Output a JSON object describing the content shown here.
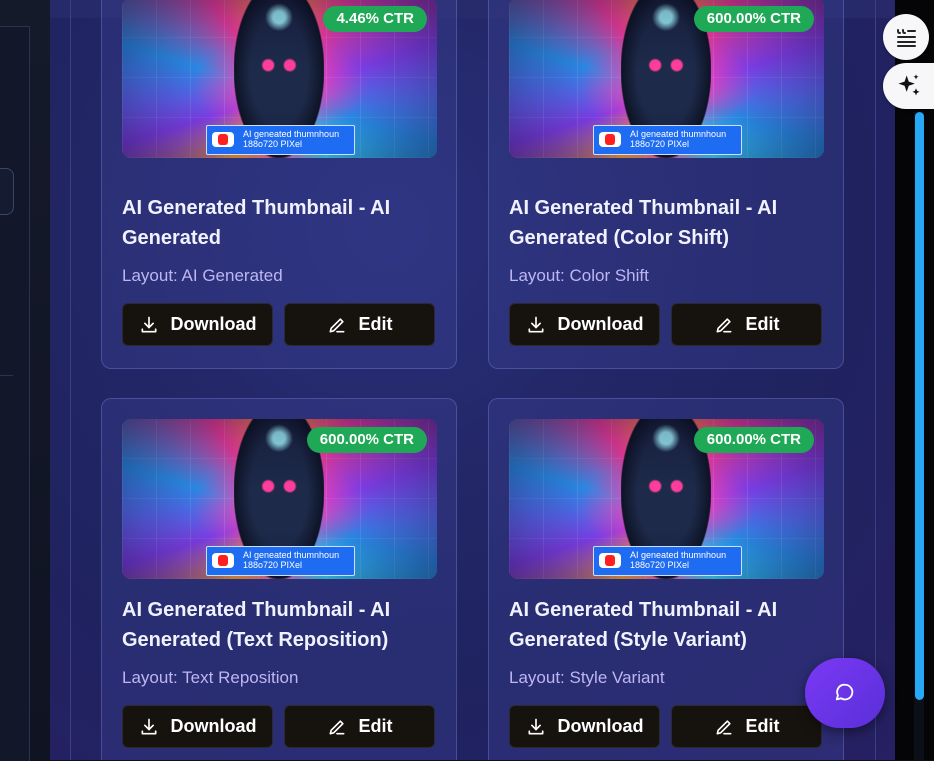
{
  "cards": [
    {
      "ctr": "4.46% CTR",
      "yt_line1": "AI geneated thumnhoun",
      "yt_line2": "188o720 PIXel",
      "title": "AI Generated Thumbnail - AI Generated",
      "layout": "Layout: AI Generated",
      "download_label": "Download",
      "edit_label": "Edit"
    },
    {
      "ctr": "600.00% CTR",
      "yt_line1": "AI geneated thumnhoun",
      "yt_line2": "188o720 PIXel",
      "title": "AI Generated Thumbnail - AI Generated (Color Shift)",
      "layout": "Layout: Color Shift",
      "download_label": "Download",
      "edit_label": "Edit"
    },
    {
      "ctr": "600.00% CTR",
      "yt_line1": "AI geneated thumnhoun",
      "yt_line2": "188o720 PIXel",
      "title": "AI Generated Thumbnail - AI Generated (Text Reposition)",
      "layout": "Layout: Text Reposition",
      "download_label": "Download",
      "edit_label": "Edit"
    },
    {
      "ctr": "600.00% CTR",
      "yt_line1": "AI geneated thumnhoun",
      "yt_line2": "188o720 PIXel",
      "title": "AI Generated Thumbnail - AI Generated (Style Variant)",
      "layout": "Layout: Style Variant",
      "download_label": "Download",
      "edit_label": "Edit"
    }
  ],
  "icons": {
    "download": "download-icon",
    "edit": "pencil-icon",
    "quote_tool": "quote-list-icon",
    "sparkle_tool": "sparkle-icon",
    "chat": "chat-bubble-icon"
  },
  "colors": {
    "ctr_badge": "#1fa855",
    "button_bg": "#16130f",
    "layout_text": "#bdb6f3",
    "scrollbar": "#27a9f5",
    "chat_button": "#6b35e8"
  }
}
